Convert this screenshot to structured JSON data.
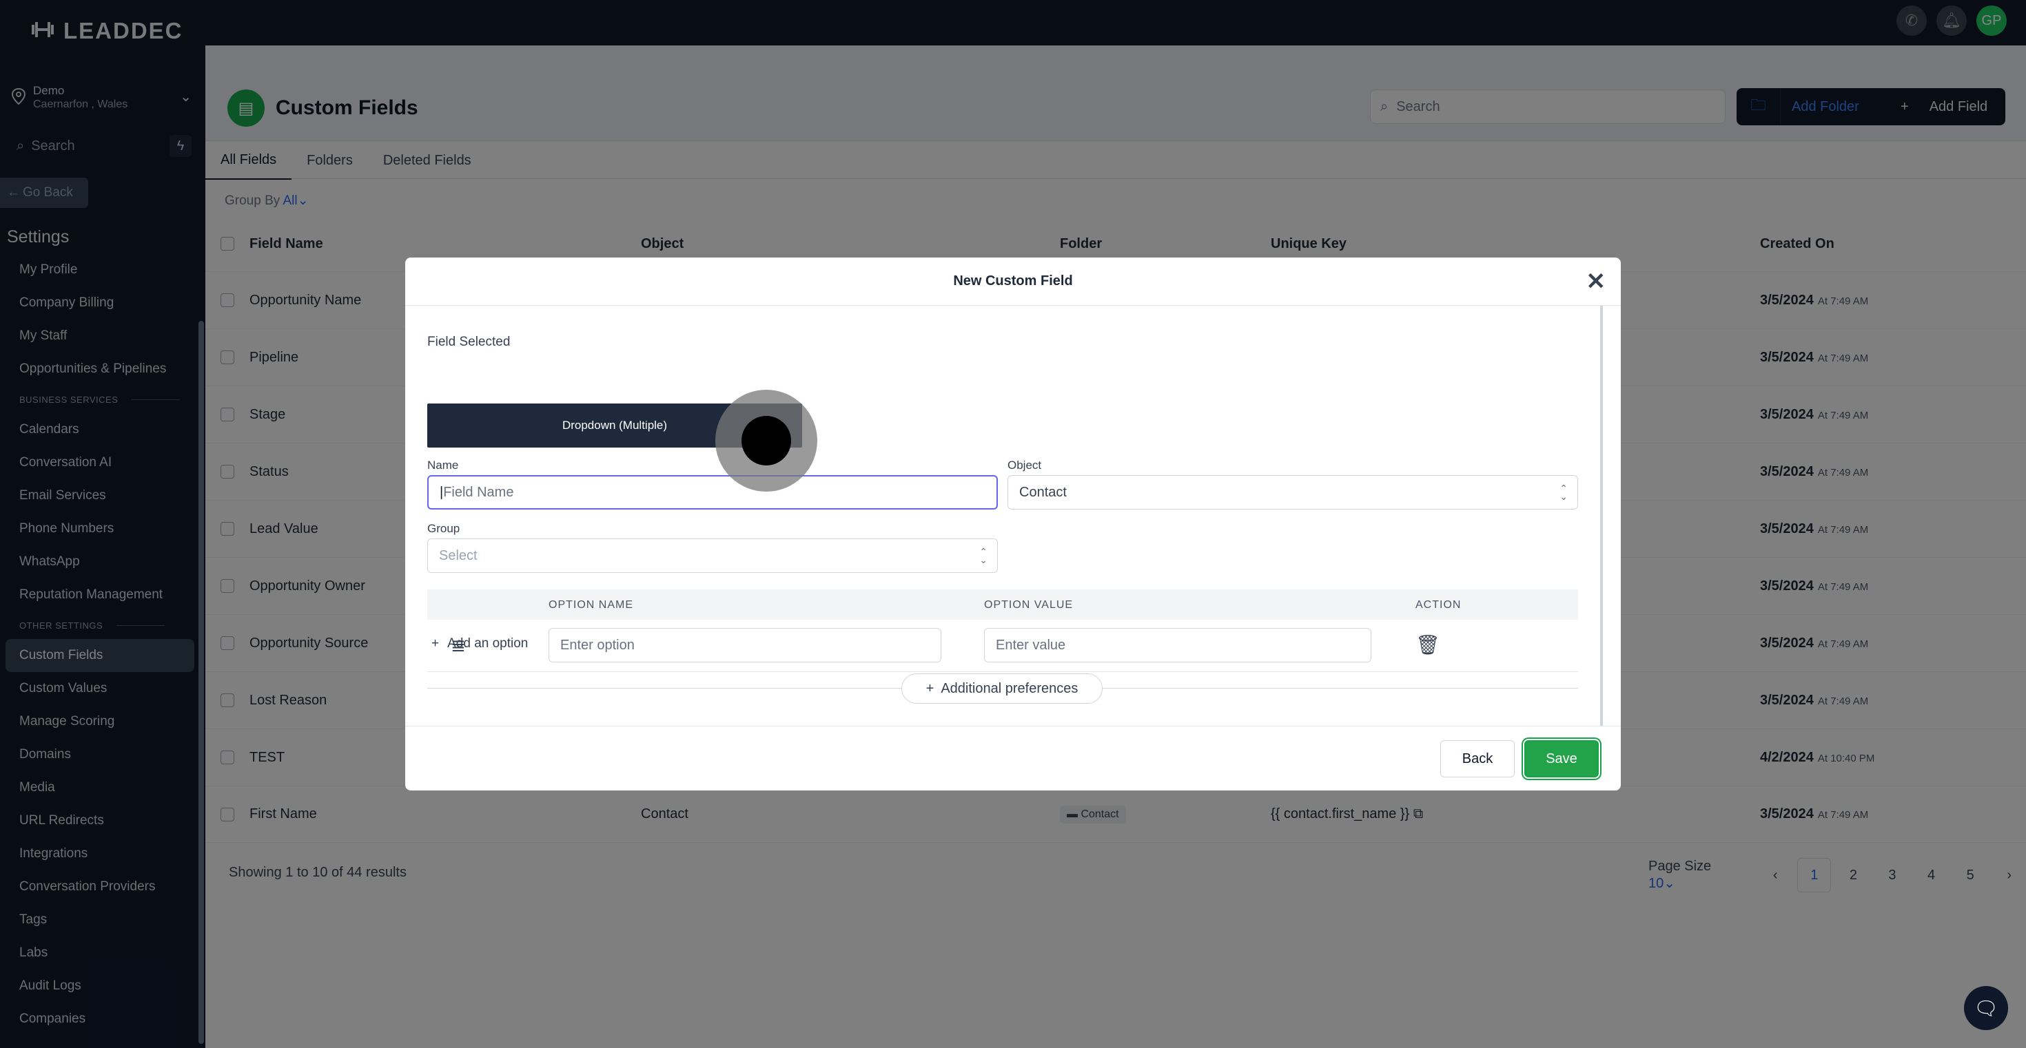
{
  "app": {
    "logo": "LEADDEC"
  },
  "location": {
    "name": "Demo",
    "address": "Caernarfon , Wales"
  },
  "sidebar": {
    "search_placeholder": "Search",
    "go_back": "Go Back",
    "settings_title": "Settings",
    "items_top": [
      "My Profile",
      "Company Billing",
      "My Staff",
      "Opportunities & Pipelines"
    ],
    "section_business": "BUSINESS SERVICES",
    "items_business": [
      "Calendars",
      "Conversation AI",
      "Email Services",
      "Phone Numbers",
      "WhatsApp",
      "Reputation Management"
    ],
    "section_other": "OTHER SETTINGS",
    "items_other": [
      "Custom Fields",
      "Custom Values",
      "Manage Scoring",
      "Domains",
      "Media",
      "URL Redirects",
      "Integrations",
      "Conversation Providers",
      "Tags",
      "Labs",
      "Audit Logs",
      "Companies"
    ]
  },
  "topbar": {
    "avatar_initials": "GP"
  },
  "page": {
    "title": "Custom Fields",
    "search_placeholder": "Search",
    "add_folder": "Add Folder",
    "add_field": "Add Field",
    "tabs": [
      "All Fields",
      "Folders",
      "Deleted Fields"
    ],
    "group_by_label": "Group By",
    "group_by_value": "All"
  },
  "table": {
    "headers": {
      "name": "Field Name",
      "object": "Object",
      "folder": "Folder",
      "key": "Unique Key",
      "created": "Created On"
    },
    "rows": [
      {
        "name": "Opportunity Name",
        "date": "3/5/2024",
        "time": "At 7:49 AM"
      },
      {
        "name": "Pipeline",
        "date": "3/5/2024",
        "time": "At 7:49 AM"
      },
      {
        "name": "Stage",
        "date": "3/5/2024",
        "time": "At 7:49 AM"
      },
      {
        "name": "Status",
        "date": "3/5/2024",
        "time": "At 7:49 AM"
      },
      {
        "name": "Lead Value",
        "date": "3/5/2024",
        "time": "At 7:49 AM"
      },
      {
        "name": "Opportunity Owner",
        "date": "3/5/2024",
        "time": "At 7:49 AM"
      },
      {
        "name": "Opportunity Source",
        "date": "3/5/2024",
        "time": "At 7:49 AM"
      },
      {
        "name": "Lost Reason",
        "date": "3/5/2024",
        "time": "At 7:49 AM"
      },
      {
        "name": "TEST",
        "date": "4/2/2024",
        "time": "At 10:40 PM"
      },
      {
        "name": "First Name",
        "object": "Contact",
        "folder": "Contact",
        "key": "{{ contact.first_name }}",
        "date": "3/5/2024",
        "time": "At 7:49 AM"
      }
    ],
    "footer": "Showing 1 to 10 of 44 results",
    "page_size_label": "Page Size",
    "page_size_value": "10",
    "pages": [
      "1",
      "2",
      "3",
      "4",
      "5"
    ]
  },
  "modal": {
    "title": "New Custom Field",
    "field_selected_label": "Field Selected",
    "field_type": "Dropdown (Multiple)",
    "name_label": "Name",
    "name_placeholder": "Field Name",
    "object_label": "Object",
    "object_value": "Contact",
    "group_label": "Group",
    "group_placeholder": "Select",
    "options_headers": {
      "name": "OPTION NAME",
      "value": "OPTION VALUE",
      "action": "ACTION"
    },
    "option_name_placeholder": "Enter option",
    "option_value_placeholder": "Enter value",
    "add_option": "Add an option",
    "additional_preferences": "Additional preferences",
    "back": "Back",
    "save": "Save"
  }
}
